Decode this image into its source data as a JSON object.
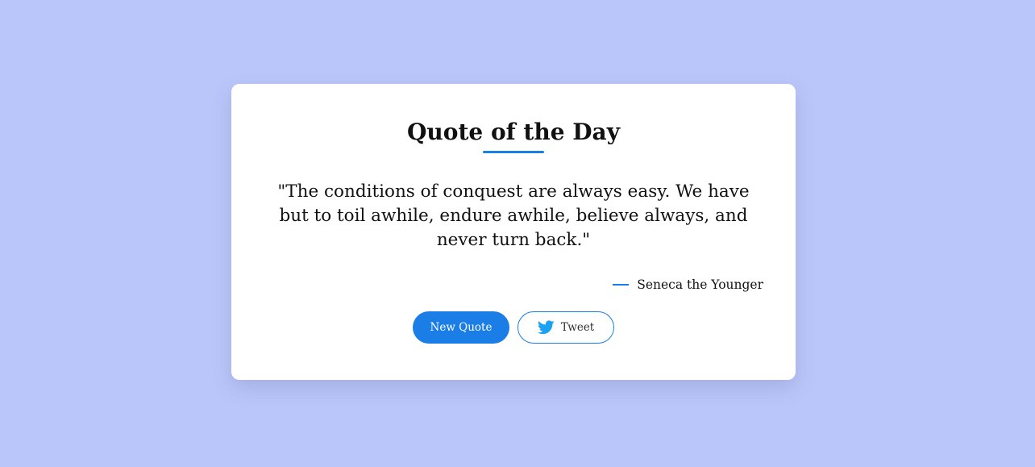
{
  "card": {
    "title": "Quote of the Day",
    "quote": "\"The conditions of conquest are always easy. We have but to toil awhile, endure awhile, believe always, and never turn back.\"",
    "author": "Seneca the Younger"
  },
  "buttons": {
    "new_quote_label": "New Quote",
    "tweet_label": "Tweet",
    "tweet_icon": "twitter-bird-icon"
  },
  "colors": {
    "background": "#bac6f9",
    "accent": "#1a7ee6",
    "twitter": "#1da1f2",
    "card": "#ffffff"
  }
}
